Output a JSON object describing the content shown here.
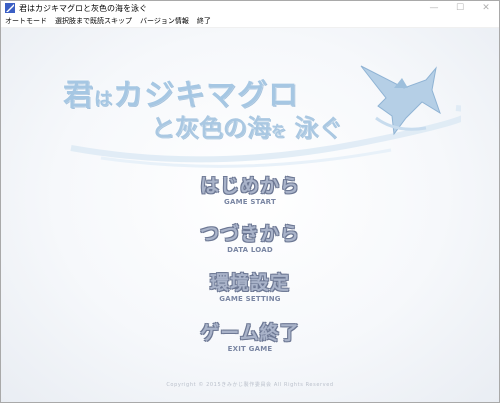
{
  "window": {
    "title": "君はカジキマグロと灰色の海を泳ぐ",
    "minimize_glyph": "—",
    "maximize_glyph": "☐",
    "close_glyph": "✕"
  },
  "menubar": {
    "items": [
      "オートモード",
      "選択肢まで既読スキップ",
      "バージョン情報",
      "終了"
    ]
  },
  "logo": {
    "line1_a": "君",
    "line1_b": "は",
    "line1_c": "カジキマグロ",
    "line2_a": "と灰色の海",
    "line2_b": "を",
    "line2_c": "泳ぐ"
  },
  "main_menu": [
    {
      "jp": "はじめから",
      "en": "GAME START"
    },
    {
      "jp": "つづきから",
      "en": "DATA LOAD"
    },
    {
      "jp": "環境設定",
      "en": "GAME SETTING"
    },
    {
      "jp": "ゲーム終了",
      "en": "EXIT GAME"
    }
  ],
  "copyright": "Copyright © 2015きみかじ製作委員会 All Rights Reserved",
  "colors": {
    "logo": "#a6c7e3",
    "menu_fill": "#a9b3c9",
    "menu_outline": "#6d7894",
    "menu_sub": "#7a86a3"
  }
}
